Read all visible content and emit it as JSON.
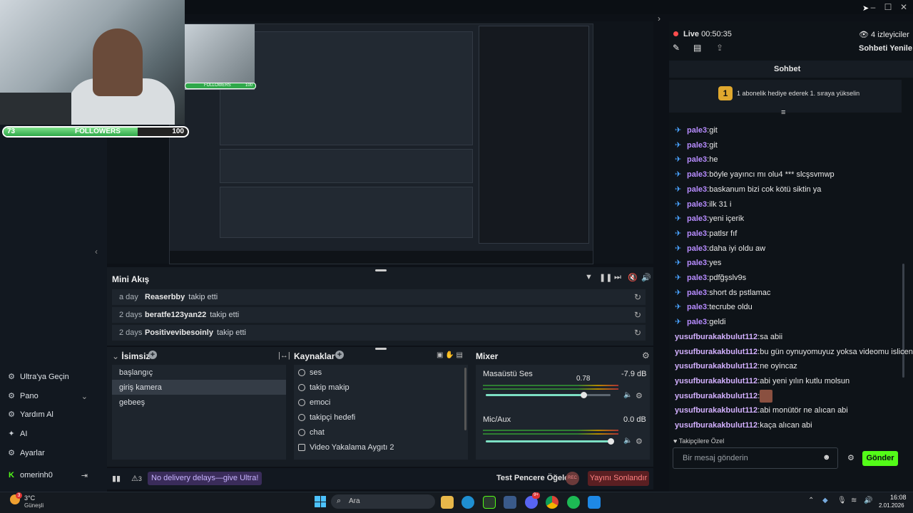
{
  "stream": {
    "live_label": "Live",
    "live_time": "00:50:35",
    "viewers": "4 izleyiciler",
    "chat_refresh": "Sohbeti Yenile",
    "chat_title": "Sohbet",
    "gift_text": "1 abonelik hediye ederek 1. sıraya yükselin",
    "gift_rank": "1"
  },
  "overlay": {
    "followers_count": "73",
    "followers_label": "FOLLOWERS",
    "followers_goal": "100",
    "followers_progress": 0.73,
    "mini_followers_label": "FOLLOWERS",
    "mini_followers_goal": "100"
  },
  "sidebar": {
    "items": [
      {
        "label": "Ultra'ya Geçin",
        "icon": "ultra-icon"
      },
      {
        "label": "Pano",
        "icon": "dashboard-icon"
      },
      {
        "label": "Yardım Al",
        "icon": "help-icon"
      },
      {
        "label": "AI",
        "icon": "ai-icon"
      },
      {
        "label": "Ayarlar",
        "icon": "settings-icon"
      }
    ],
    "user": "omerinh0"
  },
  "mini_feed": {
    "title": "Mini Akış",
    "rows": [
      {
        "time": "a day",
        "name": "Reaserbby",
        "action": "takip etti"
      },
      {
        "time": "2 days",
        "name": "beratfe123yan22",
        "action": "takip etti"
      },
      {
        "time": "2 days",
        "name": "Positivevibesoinly",
        "action": "takip etti"
      }
    ]
  },
  "scenes": {
    "title": "İsimsiz",
    "items": [
      "başlangıç",
      "giriş kamera",
      "gebeeş"
    ],
    "selected_index": 1
  },
  "sources": {
    "title": "Kaynaklar",
    "items": [
      "ses",
      "takip makip",
      "emoci",
      "takipçi hedefi",
      "chat",
      "Video Yakalama Aygıtı 2"
    ]
  },
  "mixer": {
    "title": "Mixer",
    "channels": [
      {
        "name": "Masaüstü Ses",
        "db": "-7.9 dB",
        "value_label": "0.78",
        "level": 0.78
      },
      {
        "name": "Mic/Aux",
        "db": "0.0 dB",
        "value_label": "",
        "level": 1.0
      }
    ]
  },
  "bottom_bar": {
    "alert_count": "3",
    "promo": "No delivery delays—give Ultra!",
    "test_windows": "Test Pencere Öğeleri",
    "rec": "REC",
    "end_stream": "Yayını Sonlandır"
  },
  "chat": {
    "messages": [
      {
        "user": "pale3",
        "text": "git",
        "badge": true
      },
      {
        "user": "pale3",
        "text": "git",
        "badge": true
      },
      {
        "user": "pale3",
        "text": "he",
        "badge": true
      },
      {
        "user": "pale3",
        "text": "böyle yayıncı mı olu4 *** slcşsvmwp",
        "badge": true
      },
      {
        "user": "pale3",
        "text": "baskanum bizi cok kötü siktin ya",
        "badge": true
      },
      {
        "user": "pale3",
        "text": "ilk 31 i",
        "badge": true
      },
      {
        "user": "pale3",
        "text": "yeni içerik",
        "badge": true
      },
      {
        "user": "pale3",
        "text": "patlsr fıf",
        "badge": true
      },
      {
        "user": "pale3",
        "text": "daha iyi oldu aw",
        "badge": true
      },
      {
        "user": "pale3",
        "text": "yes",
        "badge": true
      },
      {
        "user": "pale3",
        "text": "pdfğşslv9s",
        "badge": true
      },
      {
        "user": "pale3",
        "text": "short ds pstlamac",
        "badge": true
      },
      {
        "user": "pale3",
        "text": "tecrube oldu",
        "badge": true
      },
      {
        "user": "pale3",
        "text": "geldi",
        "badge": true
      },
      {
        "user": "yusufburakakbulut112",
        "text": "sa abii",
        "badge": false
      },
      {
        "user": "yusufburakakbulut112",
        "text": "bu gün oynuyomuyuz yoksa videomu islicen",
        "badge": false
      },
      {
        "user": "yusufburakakbulut112",
        "text": "ne oyincaz",
        "badge": false
      },
      {
        "user": "yusufburakakbulut112",
        "text": "abi yeni yılın kutlu molsun",
        "badge": false
      },
      {
        "user": "yusufburakakbulut112",
        "text": "",
        "badge": false,
        "emote": true
      },
      {
        "user": "yusufburakakbulut112",
        "text": "abi monütör ne alıcan abi",
        "badge": false
      },
      {
        "user": "yusufburakakbulut112",
        "text": "kaça alıcan abi",
        "badge": false
      }
    ],
    "followers_only": "Takipçilere Özel",
    "placeholder": "Bir mesaj gönderin",
    "send": "Gönder"
  },
  "taskbar": {
    "weather_temp": "3°C",
    "weather_desc": "Güneşli",
    "weather_badge": "3",
    "search_placeholder": "Ara",
    "time": "16:08",
    "date": "2.01.2026",
    "discord_badge": "9+"
  }
}
